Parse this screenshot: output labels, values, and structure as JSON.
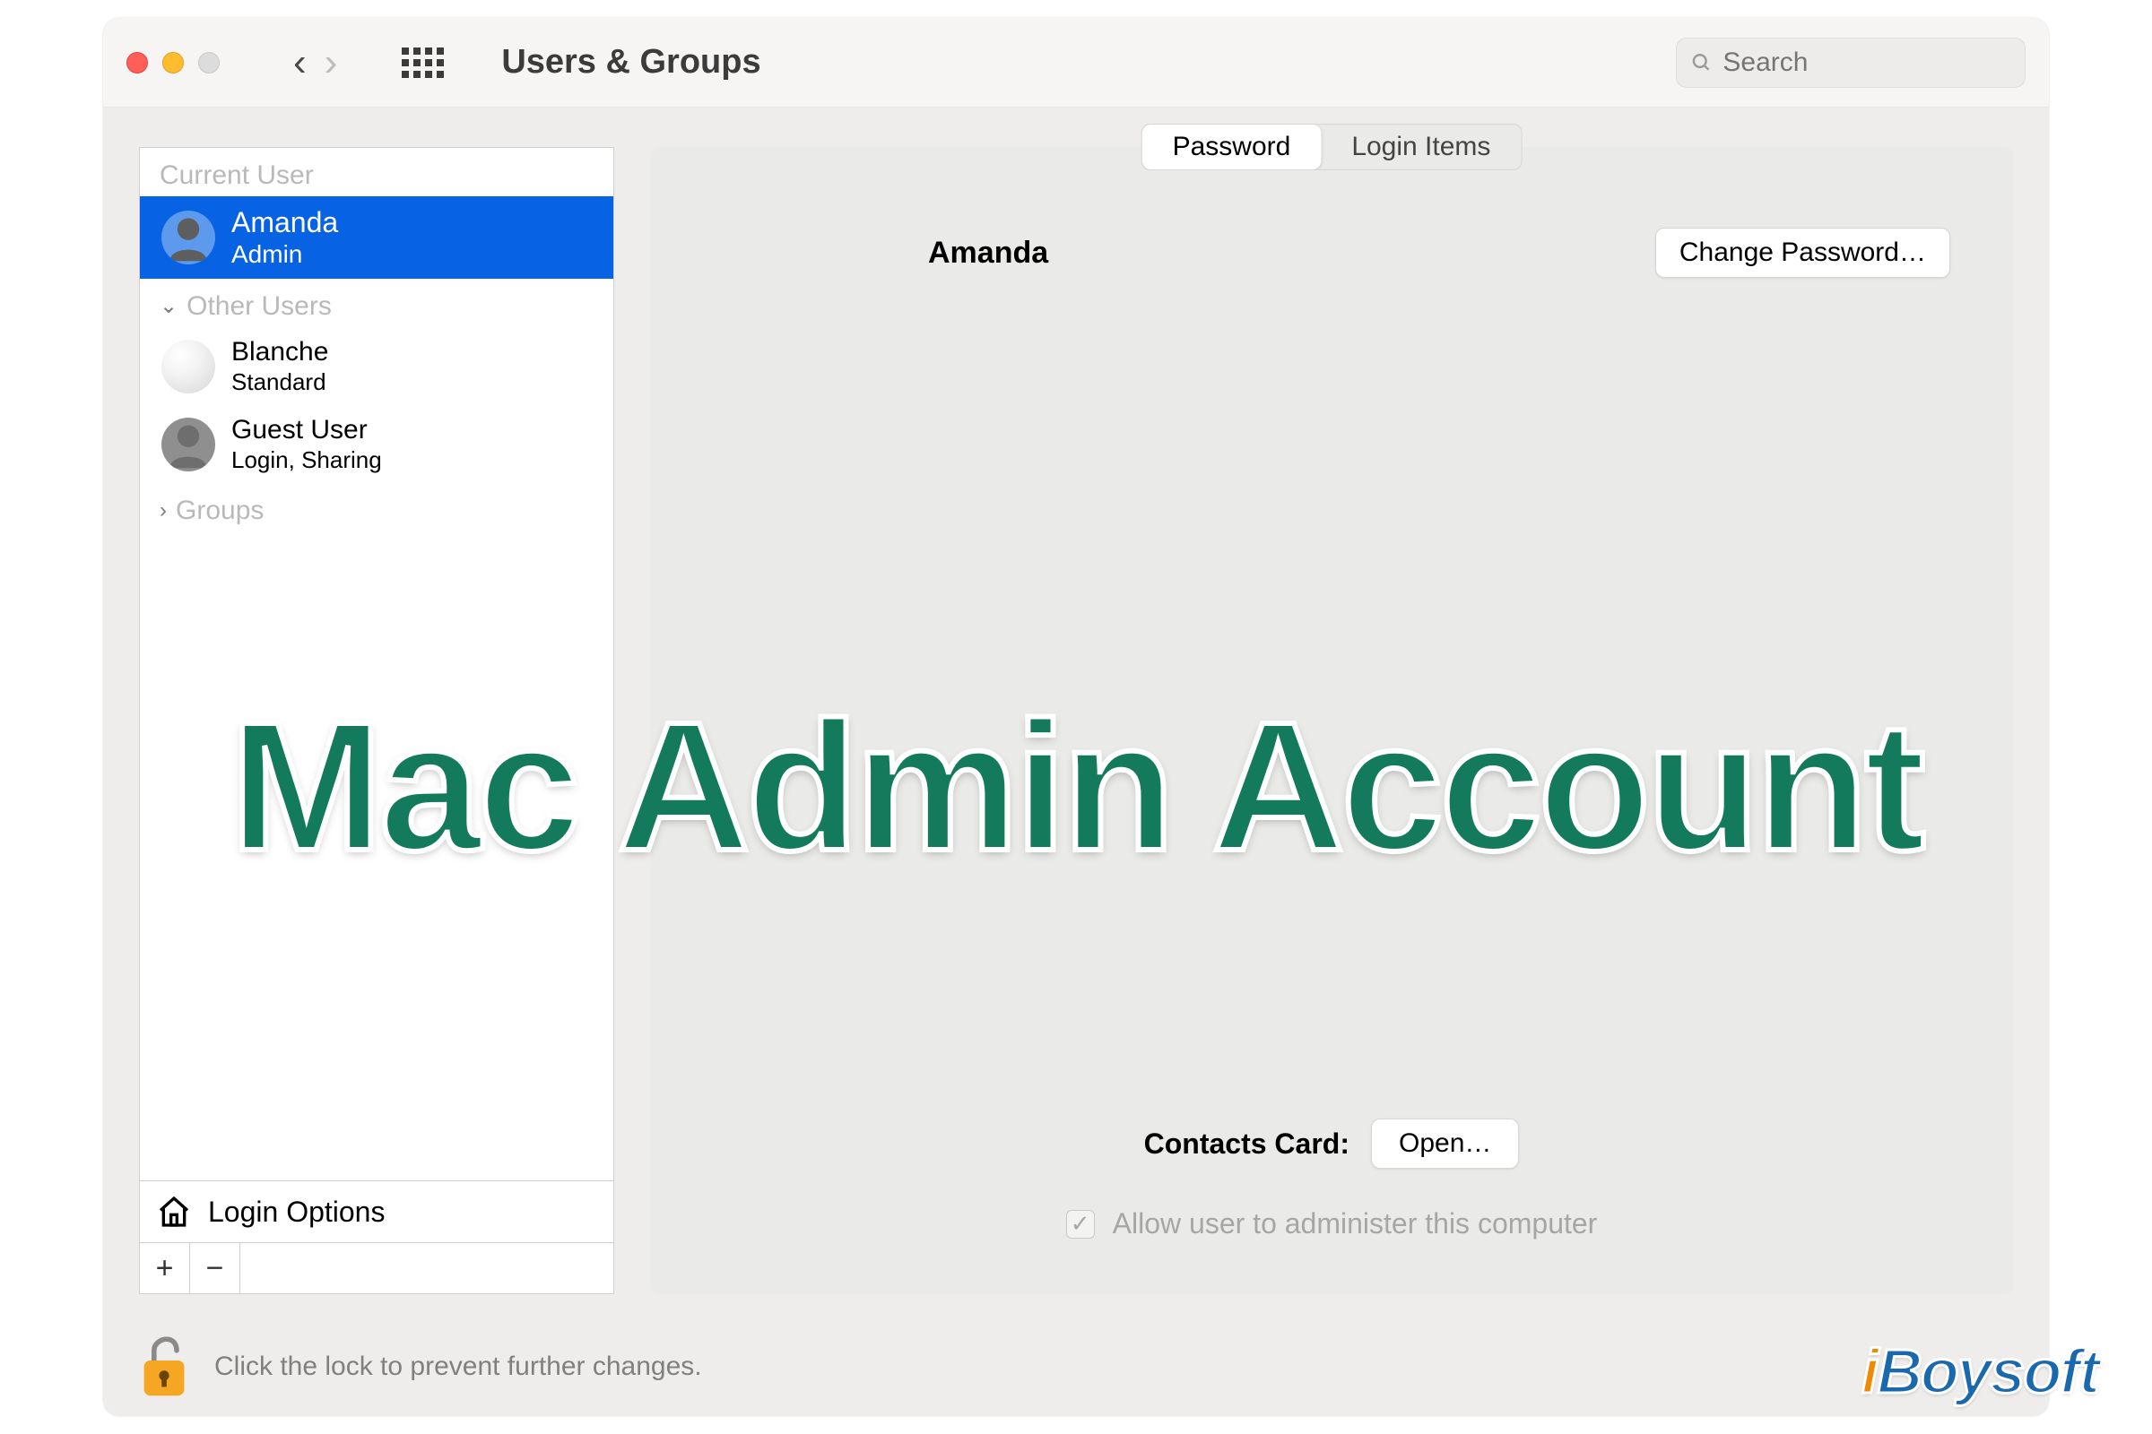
{
  "toolbar": {
    "title": "Users & Groups",
    "search_placeholder": "Search"
  },
  "sidebar": {
    "current_label": "Current User",
    "other_label": "Other Users",
    "groups_label": "Groups",
    "current": {
      "name": "Amanda",
      "role": "Admin"
    },
    "others": [
      {
        "name": "Blanche",
        "role": "Standard"
      },
      {
        "name": "Guest User",
        "role": "Login, Sharing"
      }
    ],
    "login_options": "Login Options"
  },
  "tabs": {
    "password": "Password",
    "login_items": "Login Items"
  },
  "main": {
    "user_name": "Amanda",
    "change_password": "Change Password…",
    "contacts_label": "Contacts Card:",
    "open": "Open…",
    "admin_checkbox": "Allow user to administer this computer",
    "admin_checked": true
  },
  "footer": {
    "lock_text": "Click the lock to prevent further changes."
  },
  "overlay": {
    "title": "Mac Admin Account"
  },
  "watermark": "iBoysoft"
}
